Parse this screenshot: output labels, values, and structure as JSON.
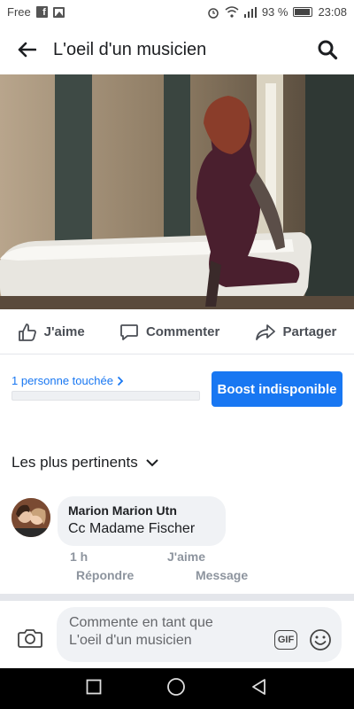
{
  "status_bar": {
    "carrier": "Free",
    "battery_percent": "93 %",
    "time": "23:08"
  },
  "header": {
    "title": "L'oeil d'un musicien"
  },
  "actions": {
    "like": "J'aime",
    "comment": "Commenter",
    "share": "Partager"
  },
  "insights": {
    "reach_text": "1 personne touchée",
    "reach_fraction": 0.0,
    "boost_label": "Boost indisponible"
  },
  "comments_section": {
    "sort_label": "Les plus pertinents",
    "comments": [
      {
        "author": "Marion Marion Utn",
        "text": "Cc Madame Fischer",
        "time": "1 h",
        "like_label": "J'aime",
        "reply_label": "Répondre",
        "message_label": "Message"
      }
    ]
  },
  "composer": {
    "placeholder_line1": "Commente en tant que",
    "placeholder_line2": "L'oeil d'un musicien",
    "gif_label": "GIF"
  },
  "colors": {
    "accent": "#1877f2",
    "text": "#1c1e21",
    "muted": "#8d949e",
    "bubble": "#f0f2f5"
  }
}
